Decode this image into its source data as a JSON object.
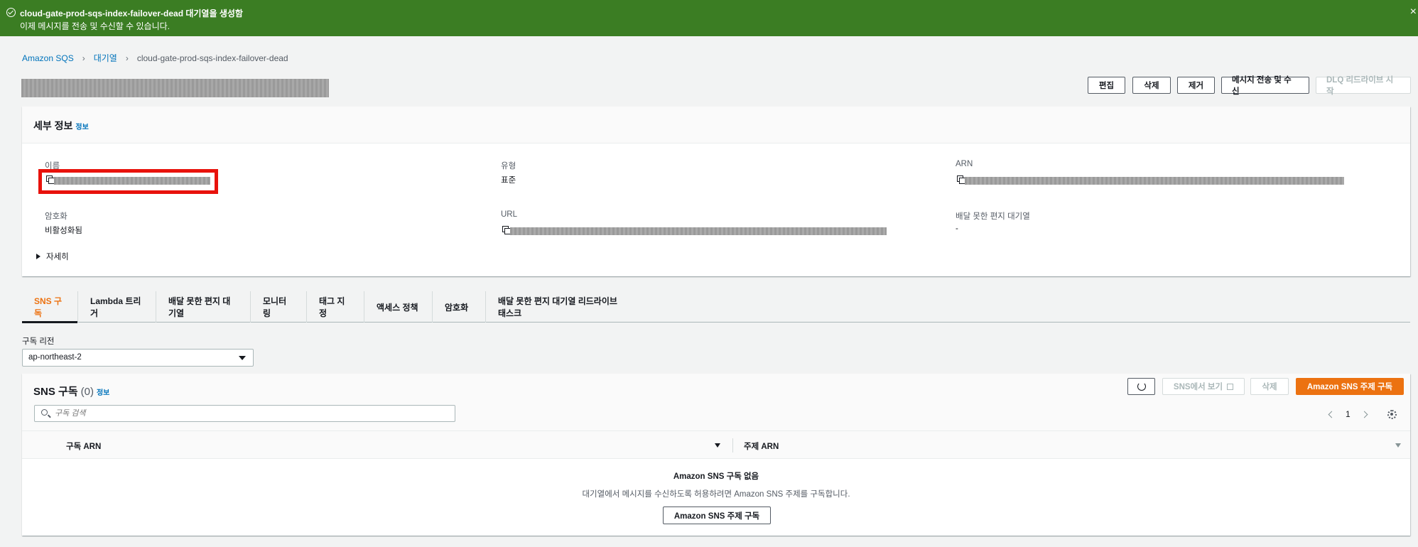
{
  "flash": {
    "title": "cloud-gate-prod-sqs-index-failover-dead 대기열을 생성함",
    "message": "이제 메시지를 전송 및 수신할 수 있습니다.",
    "close": "×"
  },
  "breadcrumb": {
    "items": [
      "Amazon SQS",
      "대기열"
    ],
    "current": "cloud-gate-prod-sqs-index-failover-dead",
    "separator": "›"
  },
  "header": {
    "actions": {
      "edit": "편집",
      "delete": "삭제",
      "purge": "제거",
      "send_receive": "메시지 전송 및 수신",
      "dlq_redrive": "DLQ 리드라이브 시작"
    }
  },
  "details": {
    "title": "세부 정보",
    "info": "정보",
    "name_label": "이름",
    "type_label": "유형",
    "type_value": "표준",
    "arn_label": "ARN",
    "encryption_label": "암호화",
    "encryption_value": "비활성화됨",
    "url_label": "URL",
    "dlq_label": "배달 못한 편지 대기열",
    "dlq_value": "-",
    "more": "자세히"
  },
  "tabs": [
    "SNS 구독",
    "Lambda 트리거",
    "배달 못한 편지 대기열",
    "모니터링",
    "태그 지정",
    "액세스 정책",
    "암호화",
    "배달 못한 편지 대기열 리드라이브 태스크"
  ],
  "region": {
    "label": "구독 리전",
    "value": "ap-northeast-2"
  },
  "sns": {
    "title": "SNS 구독",
    "count": "(0)",
    "info": "정보",
    "view_in_sns": "SNS에서 보기",
    "delete": "삭제",
    "subscribe": "Amazon SNS 주제 구독",
    "search_placeholder": "구독 검색",
    "page": "1",
    "columns": [
      "구독 ARN",
      "주제 ARN"
    ],
    "empty_title": "Amazon SNS 구독 없음",
    "empty_desc": "대기열에서 메시지를 수신하도록 허용하려면 Amazon SNS 주제를 구독합니다.",
    "empty_button": "Amazon SNS 주제 구독"
  },
  "colors": {
    "success": "#3b7d23",
    "link": "#0073bb",
    "accent": "#ec7211",
    "highlight": "#e8120c"
  }
}
